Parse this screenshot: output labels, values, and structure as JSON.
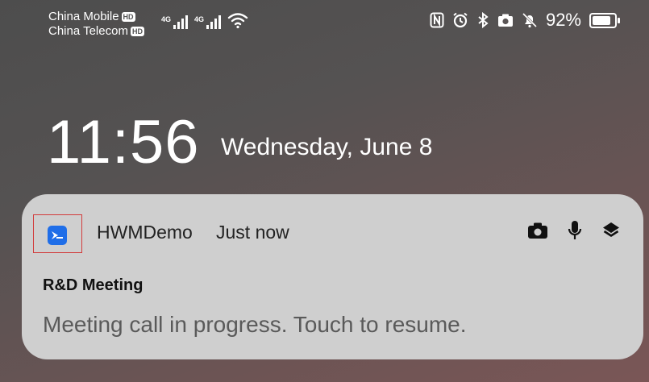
{
  "status_bar": {
    "carriers": [
      {
        "name": "China Mobile",
        "badge": "HD"
      },
      {
        "name": "China Telecom",
        "badge": "HD"
      }
    ],
    "network_labels": [
      "4G",
      "4G"
    ],
    "icons": [
      "nfc-icon",
      "alarm-icon",
      "bluetooth-icon",
      "camera-icon",
      "mute-bell-icon"
    ],
    "battery_percent": "92%"
  },
  "lock_screen": {
    "time": "11:56",
    "date": "Wednesday, June 8"
  },
  "notification": {
    "app_name": "HWMDemo",
    "time_ago": "Just now",
    "title": "R&D Meeting",
    "message": "Meeting call in progress. Touch to resume.",
    "action_icons": [
      "camera-icon",
      "microphone-icon",
      "layers-icon"
    ],
    "accent_color": "#1f6ee8"
  }
}
